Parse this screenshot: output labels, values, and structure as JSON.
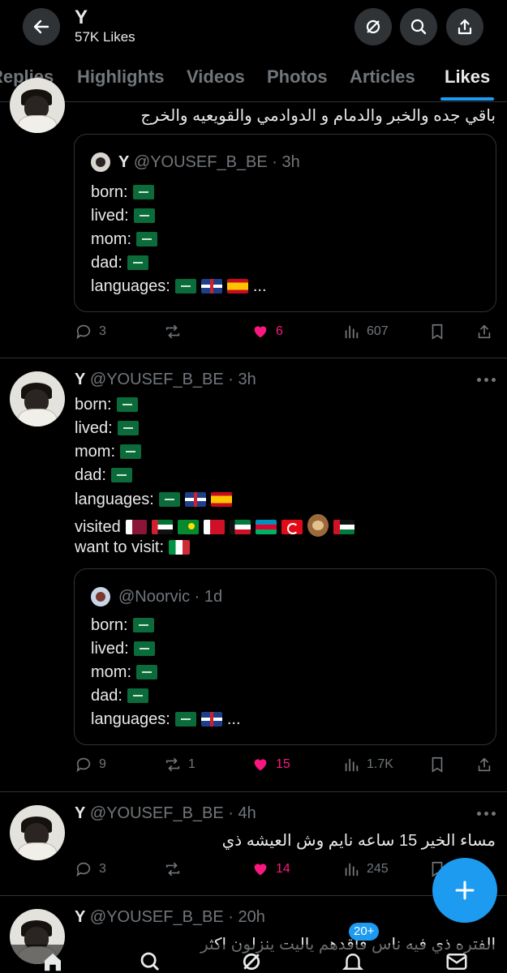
{
  "header": {
    "title": "Y",
    "subtitle": "57K Likes"
  },
  "tabs": [
    "Replies",
    "Highlights",
    "Videos",
    "Photos",
    "Articles",
    "Likes"
  ],
  "tweet1": {
    "text": "باقي جده والخبر  والدمام و الدوادمي والقويعيه والخرج",
    "quote": {
      "name": "Y",
      "handle": "@YOUSEF_B_BE",
      "time": "· 3h",
      "lines": [
        "born:",
        "lived:",
        "mom:",
        "dad:",
        "languages:"
      ],
      "ellipsis": "..."
    },
    "replies": "3",
    "likes": "6",
    "views": "607"
  },
  "tweet2": {
    "name": "Y",
    "handle": "@YOUSEF_B_BE",
    "time": "· 3h",
    "lines": [
      "born:",
      "lived:",
      "mom:",
      "dad:",
      "languages:",
      "visited",
      "want to visit:"
    ],
    "quote": {
      "handle": "@Noorvic",
      "time": "· 1d",
      "lines": [
        "born:",
        "lived:",
        "mom:",
        "dad:",
        "languages:"
      ],
      "ellipsis": "..."
    },
    "replies": "9",
    "reposts": "1",
    "likes": "15",
    "views": "1.7K"
  },
  "tweet3": {
    "name": "Y",
    "handle": "@YOUSEF_B_BE",
    "time": "· 4h",
    "text": "مساء الخير 15 ساعه نايم وش العيشه ذي",
    "replies": "3",
    "likes": "14",
    "views": "245"
  },
  "tweet4": {
    "name": "Y",
    "handle": "@YOUSEF_B_BE",
    "time": "· 20h",
    "text": "الفتره ذي فيه ناس فاقدهم ياليت ينزلون اكثر"
  },
  "bottom": {
    "badge": "20+"
  },
  "colors": {
    "accent": "#1d9bf0",
    "like": "#f91880",
    "muted": "#71767b",
    "border": "#2f3336"
  }
}
